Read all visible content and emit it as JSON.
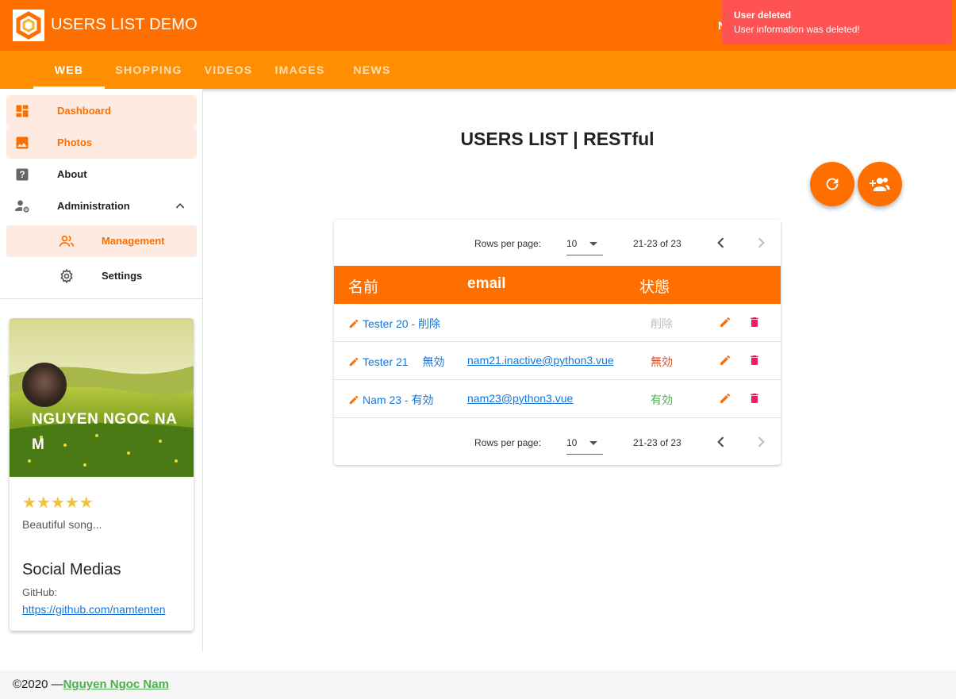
{
  "app": {
    "title": "USERS LIST DEMO",
    "header_clipped_text": "N"
  },
  "tabs": [
    {
      "label": "WEB",
      "active": true
    },
    {
      "label": "SHOPPING",
      "active": false
    },
    {
      "label": "VIDEOS",
      "active": false
    },
    {
      "label": "IMAGES",
      "active": false
    },
    {
      "label": "NEWS",
      "active": false
    }
  ],
  "snackbar": {
    "title": "User deleted",
    "message": "User information was deleted!",
    "color": "#ff5252"
  },
  "sidebar": {
    "items": [
      {
        "label": "Dashboard",
        "icon": "dashboard-icon",
        "highlighted": true
      },
      {
        "label": "Photos",
        "icon": "image-icon",
        "highlighted": true
      },
      {
        "label": "About",
        "icon": "help-icon",
        "highlighted": false
      },
      {
        "label": "Administration",
        "icon": "admin-settings-icon",
        "expanded": true
      },
      {
        "label": "Management",
        "icon": "people-icon",
        "highlighted": true
      },
      {
        "label": "Settings",
        "icon": "gear-icon",
        "highlighted": false
      }
    ]
  },
  "profile": {
    "name": "NGUYEN NGOC NAM",
    "stars": "★★★★★",
    "description": "Beautiful song...",
    "section_title": "Social Medias",
    "github_label": "GitHub:",
    "github_url": "https://github.com/namtenten"
  },
  "main": {
    "title": "USERS LIST | RESTful",
    "refresh_icon": "refresh-icon",
    "add_user_icon": "group-add-icon"
  },
  "table": {
    "rows_per_page_label": "Rows per page:",
    "rows_per_page": "10",
    "range": "21-23 of 23",
    "headers": {
      "name": "名前",
      "email": "email",
      "status": "状態"
    },
    "rows": [
      {
        "name": "Tester 20 - 削除",
        "email": "",
        "status": "削除",
        "status_color": "#bdbdbd"
      },
      {
        "name": "Tester 21　 無効",
        "email": "nam21.inactive@python3.vue",
        "status": "無効",
        "status_color": "#e64a19"
      },
      {
        "name": "Nam 23 - 有効",
        "email": "nam23@python3.vue",
        "status": "有効",
        "status_color": "#4caf50"
      }
    ]
  },
  "footer": {
    "prefix": "©2020 —",
    "author": "Nguyen Ngoc Nam"
  },
  "colors": {
    "primary": "#ff6f00",
    "tabs_bg": "#ff8f00",
    "highlight_bg": "#fdeae0",
    "delete": "#e91e63",
    "link": "#1976d2"
  }
}
